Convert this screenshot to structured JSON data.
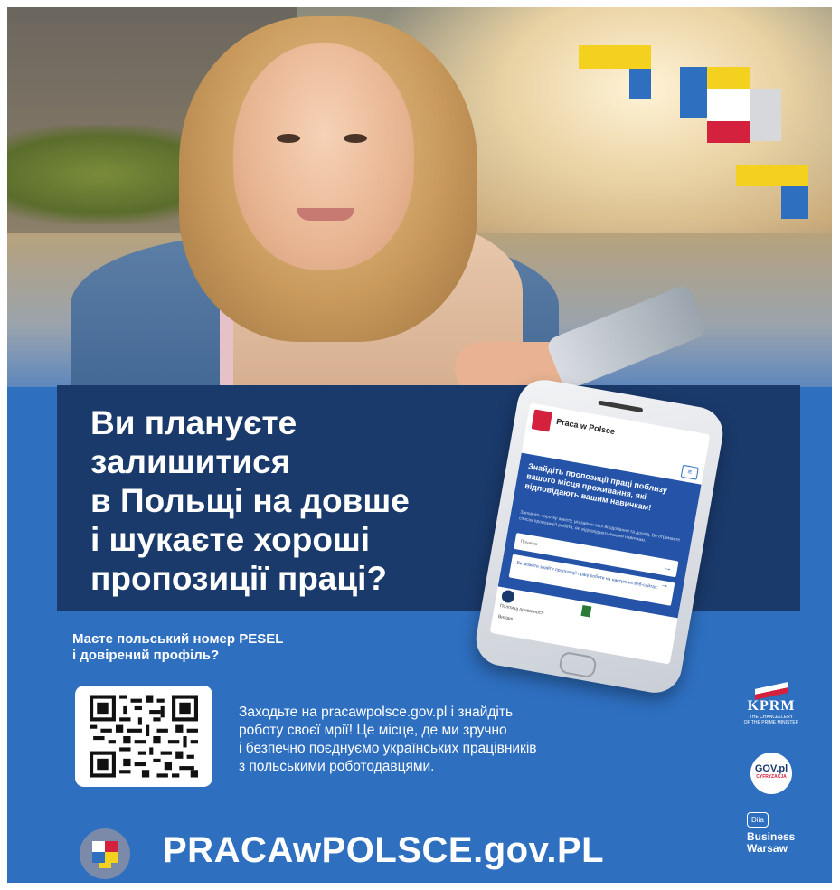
{
  "headline": {
    "line1": "Ви плануєте",
    "line2": "залишитися",
    "line3": "в Польщі на довше",
    "line4": "і шукаєте хороші",
    "line5": "пропозиції праці?"
  },
  "phone_mockup": {
    "app_name": "Praca w Polsce",
    "hero_title": "Знайдіть пропозиції праці поблизу вашого місця проживання, які відповідають вашим навичкам!",
    "hero_sub": "Заповніть коротку анкету, указавши свої вподобання та досвід. Ви отримаєте список пропозицій роботи, які відповідають вашим навичкам.",
    "field1": "Почнімо",
    "field2": "Ви можете знайти пропозиції праці роботи на наступних веб-сайтах:",
    "footer1": "Політика приватності",
    "footer2": "Вихідні"
  },
  "pesel_question": {
    "line1": "Маєте польський номер PESEL",
    "line2": "і довірений профіль?"
  },
  "description": {
    "line1": "Заходьте на pracawpolsce.gov.pl і знайдіть",
    "line2": "роботу своєї мрії! Це місце, де ми зручно",
    "line3": "і безпечно поєднуємо українських працівників",
    "line4": "з польськими роботодавцями."
  },
  "logos": {
    "kprm": "KPRM",
    "kprm_sub1": "THE CHANCELLERY",
    "kprm_sub2": "OF THE PRIME MINISTER",
    "gov": "GOV.pl",
    "gov_sub": "CYFRYZACJA",
    "diia": "Diia",
    "business_line1": "Business",
    "business_line2": "Warsaw"
  },
  "brand": "PRACAwPOLSCE.gov.PL",
  "colors": {
    "blue": "#2e6fc0",
    "navy": "#1a3a6c",
    "yellow": "#f4d11e",
    "red": "#d4213d",
    "gray": "#d6d8db"
  }
}
